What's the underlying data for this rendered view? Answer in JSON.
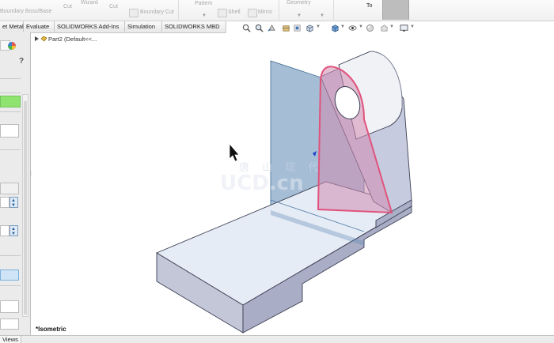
{
  "ribbon": {
    "items": [
      "Boundary Boss/Base",
      "Cut",
      "Wizard",
      "Cut",
      "Boundary Cut",
      "Pattern",
      "Shell",
      "Mirror",
      "Geometry",
      "To"
    ]
  },
  "command_tabs": [
    "et Metal",
    "Evaluate",
    "SOLIDWORKS Add-Ins",
    "Simulation",
    "SOLIDWORKS MBD"
  ],
  "tree": {
    "part_label": "Part2  (Default<<..."
  },
  "panel": {
    "help_label": "?"
  },
  "viewport": {
    "view_orientation": "*Isometric"
  },
  "watermark": {
    "text": "唐 山 现 代",
    "subtext": "UCD.cn"
  },
  "bottom": {
    "tab_label": "Views"
  },
  "colors": {
    "part_fill": "#e6ecf5",
    "part_side": "#a7acc4",
    "plane": "#5b88b5",
    "selected_face": "#e0537b",
    "active_green": "#8fe36f"
  },
  "icons": [
    "zoom-to-fit-icon",
    "zoom-area-icon",
    "previous-view-icon",
    "section-view-icon",
    "view-orientation-icon",
    "display-style-icon",
    "hide-show-icon",
    "edit-appearance-icon",
    "apply-scene-icon",
    "view-settings-icon",
    "display-pane-icon"
  ]
}
